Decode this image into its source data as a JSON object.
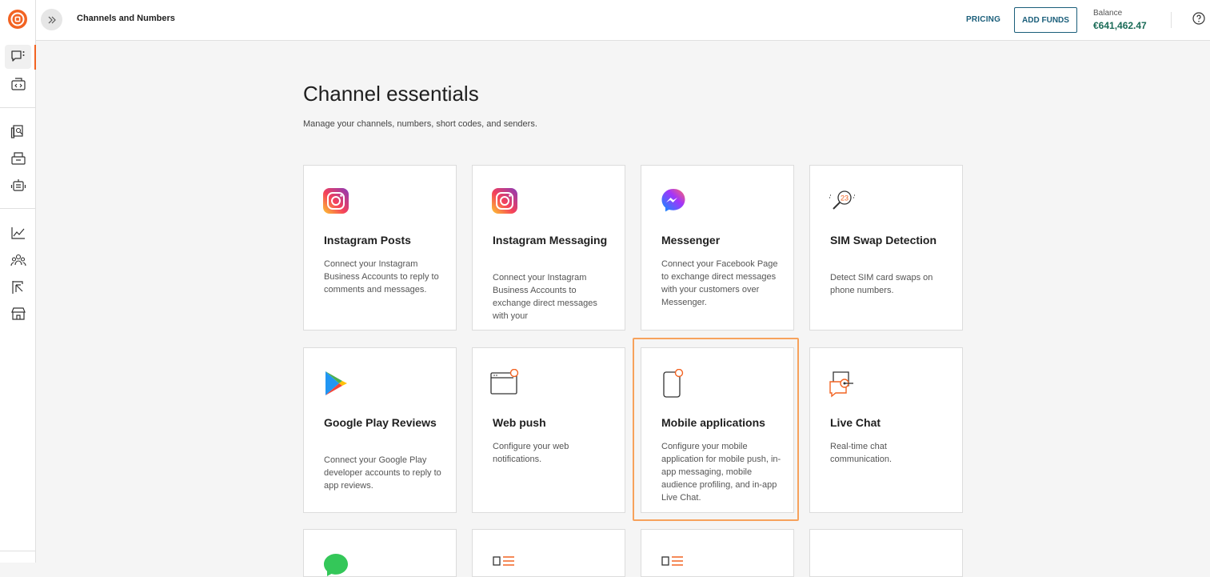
{
  "header": {
    "page_name": "Channels and Numbers",
    "pricing": "PRICING",
    "add_funds": "ADD FUNDS",
    "balance_label": "Balance",
    "balance_value": "€641,462.47"
  },
  "main": {
    "title": "Channel essentials",
    "subtitle": "Manage your channels, numbers, short codes, and senders."
  },
  "cards": [
    {
      "title": "Instagram Posts",
      "desc": "Connect your Instagram Business Accounts to reply to comments and messages.",
      "icon": "instagram-icon"
    },
    {
      "title": "Instagram Messaging",
      "desc": "Connect your Instagram Business Accounts to exchange direct messages with your",
      "icon": "instagram-icon"
    },
    {
      "title": "Messenger",
      "desc": "Connect your Facebook Page to exchange direct messages with your customers over Messenger.",
      "icon": "messenger-icon"
    },
    {
      "title": "SIM Swap Detection",
      "desc": "Detect SIM card swaps on phone numbers.",
      "icon": "sim-swap-icon"
    },
    {
      "title": "Google Play Reviews",
      "desc": "Connect your Google Play developer accounts to reply to app reviews.",
      "icon": "google-play-icon"
    },
    {
      "title": "Web push",
      "desc": "Configure your web notifications.",
      "icon": "web-push-icon"
    },
    {
      "title": "Mobile applications",
      "desc": "Configure your mobile application for mobile push, in-app messaging, mobile audience profiling, and in-app Live Chat.",
      "icon": "mobile-app-icon"
    },
    {
      "title": "Live Chat",
      "desc": "Real-time chat communication.",
      "icon": "live-chat-icon"
    }
  ],
  "colors": {
    "accent": "#f26322",
    "primary": "#1a5e7a",
    "balance": "#1a6b57",
    "focus": "#f7a25c"
  }
}
